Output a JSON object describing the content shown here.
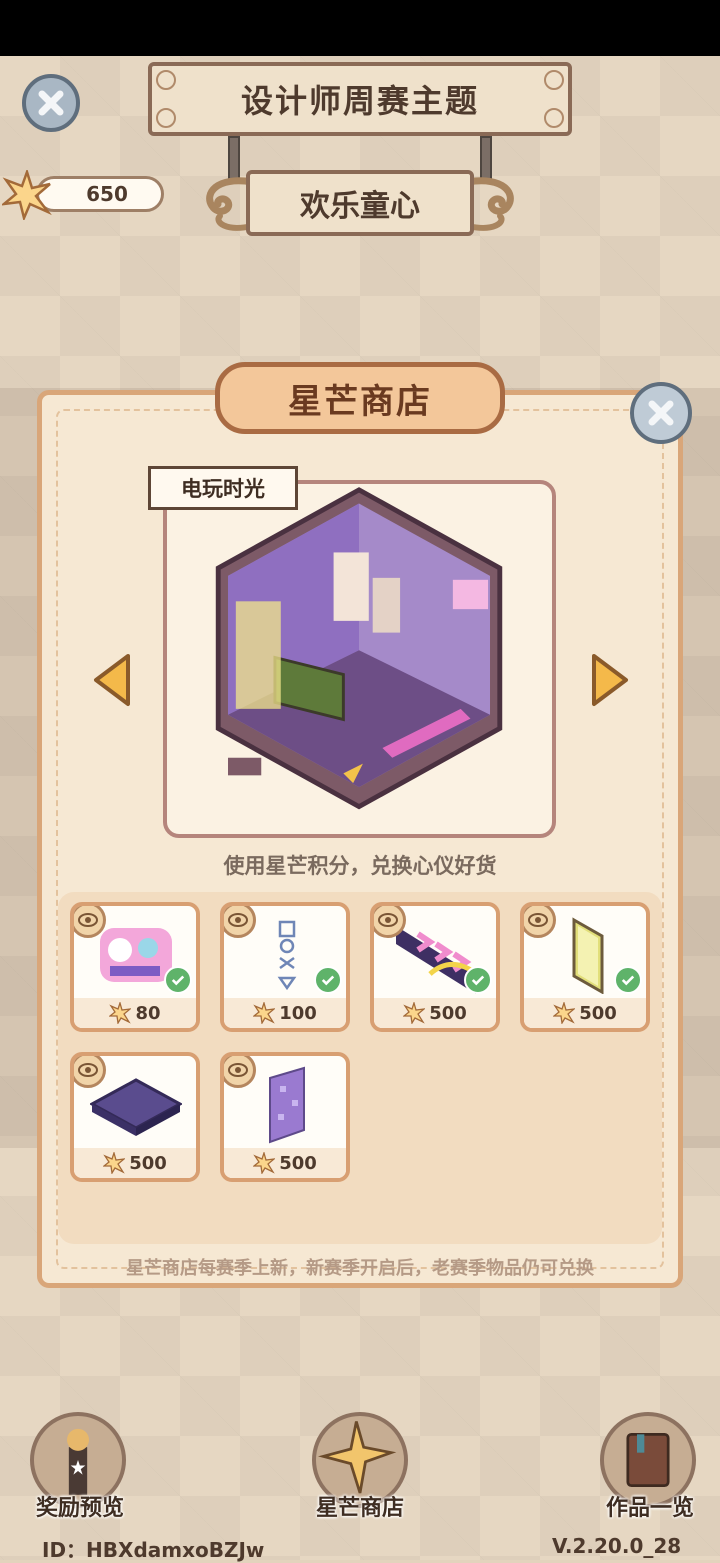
{
  "header": {
    "banner_title": "设计师周赛主题",
    "theme_name": "欢乐童心",
    "star_points": "650"
  },
  "shop": {
    "title": "星芒商店",
    "room_name": "电玩时光",
    "subtitle": "使用星芒积分，兑换心仪好货",
    "footnote": "星芒商店每赛季上新，新赛季开启后，老赛季物品仍可兑换",
    "items": [
      {
        "price": "80",
        "owned": true,
        "icon": "wall-sticker-icon"
      },
      {
        "price": "100",
        "owned": true,
        "icon": "neon-sign-icon"
      },
      {
        "price": "500",
        "owned": true,
        "icon": "neon-arrows-icon"
      },
      {
        "price": "500",
        "owned": true,
        "icon": "glass-panel-icon"
      },
      {
        "price": "500",
        "owned": false,
        "icon": "floor-tile-icon"
      },
      {
        "price": "500",
        "owned": false,
        "icon": "wallpaper-icon"
      }
    ]
  },
  "bottom_nav": {
    "rewards": "奖励预览",
    "shop": "星芒商店",
    "works": "作品一览"
  },
  "footer": {
    "id": "ID：HBXdamxoBZJw",
    "version": "V.2.20.0_28"
  }
}
